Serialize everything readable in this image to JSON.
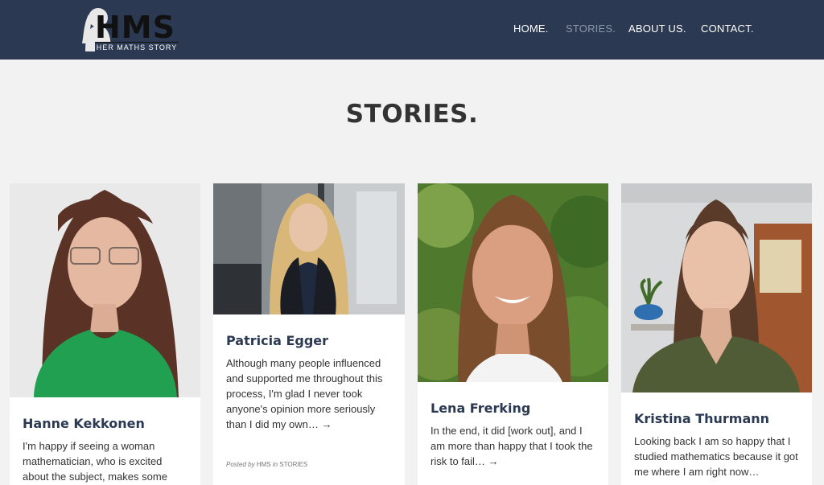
{
  "header": {
    "logo": {
      "title": "HMS",
      "subtitle": "HER MATHS STORY"
    },
    "nav": [
      {
        "label": "HOME.",
        "active": false
      },
      {
        "label": "STORIES.",
        "active": true
      },
      {
        "label": "ABOUT US.",
        "active": false
      },
      {
        "label": "CONTACT.",
        "active": false
      }
    ]
  },
  "page": {
    "title": "STORIES."
  },
  "cards": [
    {
      "name": "Hanne Kekkonen",
      "excerpt": "I'm happy if seeing a woman mathematician, who is excited about the subject, makes some"
    },
    {
      "name": "Patricia Egger",
      "excerpt": "Although many people influenced and supported me throughout this process, I'm glad I never took anyone's opinion more seriously than I did my own… →",
      "meta": {
        "posted_by": "Posted by",
        "author": "HMS",
        "in": "in",
        "category": "STORIES"
      }
    },
    {
      "name": "Lena Frerking",
      "excerpt": "In the end, it did [work out], and I am more than happy that I took the risk to fail… →"
    },
    {
      "name": "Kristina Thurmann",
      "excerpt": "Looking back I am so happy that I studied mathematics because it got me where I am right now…"
    }
  ]
}
